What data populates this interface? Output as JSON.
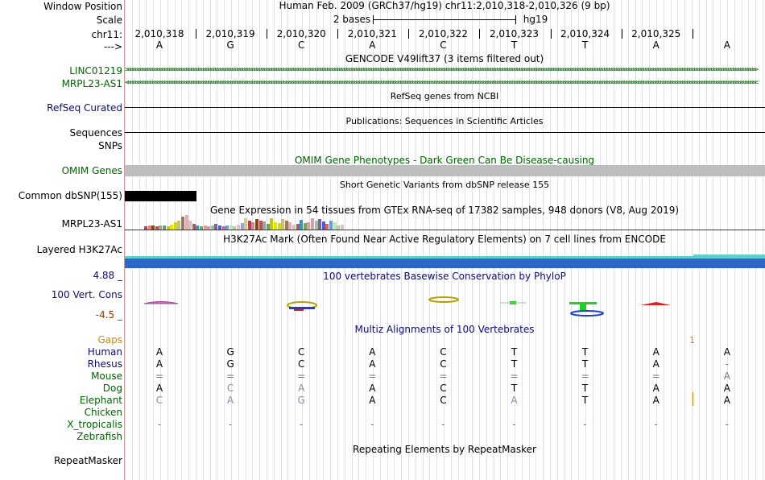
{
  "colors": {
    "green": "#006400",
    "navy": "#0c0c78",
    "phylo_low": "#8b3a0a",
    "gaps": "#d28a00",
    "omim_bar": "#bebebe",
    "h3k27ac_top": "#5fd0d0",
    "h3k27ac_body": "#2e66c8"
  },
  "labels": {
    "window_position": "Window Position",
    "scale": "Scale",
    "chr": "chr11:",
    "strand": "--->",
    "linc": "LINC01219",
    "mrpl": "MRPL23-AS1",
    "refseq": "RefSeq Curated",
    "sequences": "Sequences",
    "snps": "SNPs",
    "omim": "OMIM Genes",
    "common_dbsnp": "Common dbSNP(155)",
    "gtex_gene": "MRPL23-AS1",
    "h3k27ac": "Layered H3K27Ac",
    "phylo_max": "4.88 _",
    "phylo_track": "100 Vert. Cons",
    "phylo_min": "-4.5 _",
    "gaps": "Gaps",
    "species": [
      "Human",
      "Rhesus",
      "Mouse",
      "Dog",
      "Elephant",
      "Chicken",
      "X_tropicalis",
      "Zebrafish"
    ],
    "repeatmasker": "RepeatMasker"
  },
  "titles": {
    "assembly": "Human Feb. 2009 (GRCh37/hg19)   chr11:2,010,318-2,010,326 (9 bp)",
    "scale_bases": "2 bases",
    "scale_db": "hg19",
    "gencode": "GENCODE V49lift37 (3 items filtered out)",
    "refseq": "RefSeq genes from NCBI",
    "publications": "Publications: Sequences in Scientific Articles",
    "omim": "OMIM Gene Phenotypes - Dark Green Can Be Disease-causing",
    "dbsnp": "Short Genetic Variants from dbSNP release 155",
    "gtex": "Gene Expression in 54 tissues from GTEx RNA-seq of 17382 samples, 948 donors (V8, Aug 2019)",
    "h3k27ac": "H3K27Ac Mark (Often Found Near Active Regulatory Elements) on 7 cell lines from ENCODE",
    "phylop": "100 vertebrates Basewise Conservation by PhyloP",
    "multiz": "Multiz Alignments of 100 Vertebrates",
    "gaps_count": "1",
    "repeatmasker": "Repeating Elements by RepeatMasker"
  },
  "ruler_positions": [
    "2,010,318",
    "2,010,319",
    "2,010,320",
    "2,010,321",
    "2,010,322",
    "2,010,323",
    "2,010,324",
    "2,010,325"
  ],
  "ruler_bases": [
    "A",
    "G",
    "C",
    "A",
    "C",
    "T",
    "T",
    "A",
    "A"
  ],
  "alignment": {
    "Human": [
      "A",
      "G",
      "C",
      "A",
      "C",
      "T",
      "T",
      "A",
      "A"
    ],
    "Rhesus": [
      "A",
      "G",
      "C",
      "A",
      "C",
      "T",
      "T",
      "A",
      "-"
    ],
    "Mouse": [
      "=",
      "=",
      "=",
      "=",
      "=",
      "=",
      "=",
      "=",
      "A"
    ],
    "Dog": [
      "A",
      "C",
      "A",
      "A",
      "C",
      "T",
      "T",
      "A",
      "A"
    ],
    "Elephant": [
      "C",
      "A",
      "G",
      "A",
      "C",
      "A",
      "T",
      "A",
      "A"
    ],
    "Chicken": [
      "",
      "",
      "",
      "",
      "",
      "",
      "",
      "",
      ""
    ],
    "X_tropicalis": [
      "-",
      "-",
      "-",
      "-",
      "-",
      "-",
      "-",
      "-",
      "-"
    ],
    "Zebrafish": [
      "",
      "",
      "",
      "",
      "",
      "",
      "",
      "",
      ""
    ]
  },
  "gtex_values": [
    0.2,
    0.3,
    0.25,
    0.2,
    0.25,
    0.3,
    0.22,
    0.35,
    0.5,
    0.6,
    0.9,
    1.0,
    0.6,
    0.4,
    0.3,
    0.2,
    0.25,
    0.2,
    0.3,
    0.4,
    0.25,
    0.2,
    0.3,
    0.25,
    0.2,
    0.35,
    0.45,
    0.8,
    0.6,
    0.5,
    0.7,
    0.6,
    0.55,
    0.4,
    0.8,
    0.5,
    0.45,
    0.7,
    0.6,
    0.5,
    0.35,
    0.4,
    0.65,
    0.45,
    0.5,
    0.8,
    0.6,
    0.7,
    0.55,
    0.4,
    0.6,
    0.5,
    0.3,
    0.35
  ]
}
